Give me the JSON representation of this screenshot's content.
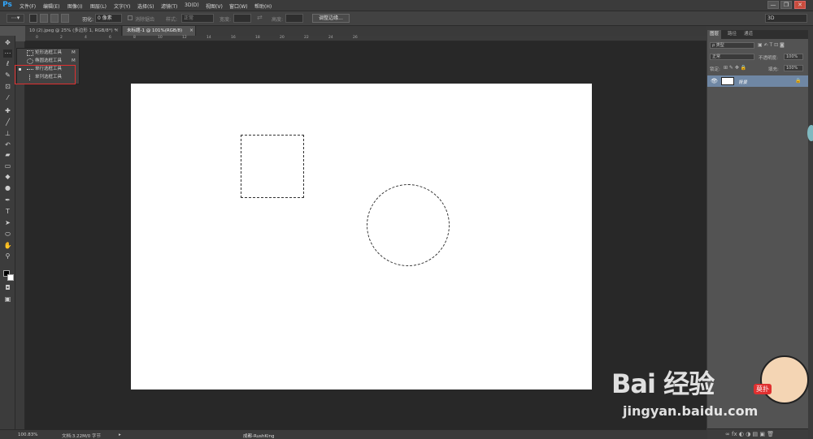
{
  "app": {
    "logo": "Ps"
  },
  "menu": [
    "文件(F)",
    "编辑(E)",
    "图像(I)",
    "图层(L)",
    "文字(Y)",
    "选择(S)",
    "滤镜(T)",
    "3D(D)",
    "视图(V)",
    "窗口(W)",
    "帮助(H)"
  ],
  "window_buttons": {
    "minimize": "—",
    "restore": "❐",
    "close": "✕"
  },
  "options_bar": {
    "feather_label": "羽化:",
    "feather_value": "0 像素",
    "antialias_label": "消除锯齿",
    "style_label": "样式:",
    "style_value": "正常",
    "width_label": "宽度:",
    "height_label": "高度:",
    "refine_button": "调整边缘...",
    "workspace_value": "3D"
  },
  "tabs": [
    {
      "label": "10 (2).jpeg @ 25% (多边形 1, RGB/8*) *",
      "close": "×"
    },
    {
      "label": "未标题-1 @ 101%(RGB/8)",
      "close": "×"
    }
  ],
  "ruler_ticks": [
    "0",
    "2",
    "4",
    "6",
    "8",
    "10",
    "12",
    "14",
    "16",
    "18",
    "20",
    "22",
    "24",
    "26"
  ],
  "flyout": {
    "items": [
      {
        "label": "矩形选框工具",
        "key": "M"
      },
      {
        "label": "椭圆选框工具",
        "key": "M"
      },
      {
        "label": "单行选框工具",
        "key": ""
      },
      {
        "label": "单列选框工具",
        "key": ""
      }
    ]
  },
  "status": {
    "zoom": "100.83%",
    "doc": "文档:3.22M/0 字节",
    "credit": "成都-RushKing"
  },
  "panel": {
    "tabs": [
      "图层",
      "路径",
      "通道"
    ],
    "kind_label": "ρ 类型",
    "blend_mode": "正常",
    "opacity_label": "不透明度:",
    "opacity_value": "100%",
    "lock_label": "锁定:",
    "fill_label": "填充:",
    "fill_value": "100%",
    "layer_name": "背景"
  },
  "watermark": {
    "brand": "Bai 经验",
    "url": "jingyan.baidu.com",
    "badge": "莫扑"
  },
  "colors": {
    "accent": "#31a8ff",
    "highlight": "#e03030",
    "layer_selected": "#6f87a4"
  }
}
